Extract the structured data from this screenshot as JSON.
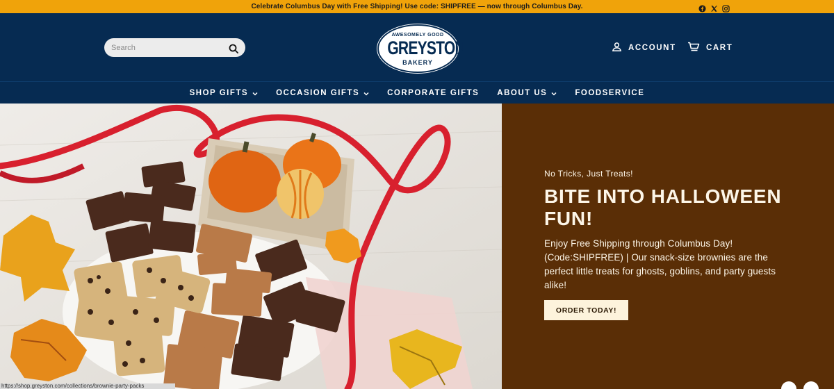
{
  "announcement": {
    "text": "Celebrate Columbus Day with Free Shipping! Use code: SHIPFREE — now through Columbus Day.",
    "socials": [
      "facebook-icon",
      "x-icon",
      "instagram-icon"
    ]
  },
  "header": {
    "search_placeholder": "Search",
    "logo": {
      "top": "AWESOMELY GOOD",
      "main": "GREYSTON",
      "bottom": "BAKERY"
    },
    "account_label": "ACCOUNT",
    "cart_label": "CART"
  },
  "nav": {
    "items": [
      {
        "label": "SHOP GIFTS",
        "has_dropdown": true
      },
      {
        "label": "OCCASION GIFTS",
        "has_dropdown": true
      },
      {
        "label": "CORPORATE GIFTS",
        "has_dropdown": false
      },
      {
        "label": "ABOUT US",
        "has_dropdown": true
      },
      {
        "label": "FOODSERVICE",
        "has_dropdown": false
      }
    ]
  },
  "hero": {
    "eyebrow": "No Tricks, Just Treats!",
    "headline": "BITE INTO HALLOWEEN FUN!",
    "copy": "Enjoy Free Shipping through Columbus Day! (Code:SHIPFREE) | Our snack-size brownies are the perfect little treats for ghosts, goblins, and party guests alike!",
    "cta_label": "ORDER TODAY!"
  },
  "status_url": "https://shop.greyston.com/collections/brownie-party-packs",
  "colors": {
    "announce_bg": "#f0a30a",
    "header_bg": "#062b52",
    "hero_panel_bg": "#5a2e06",
    "cta_bg": "#fdf3dc"
  }
}
